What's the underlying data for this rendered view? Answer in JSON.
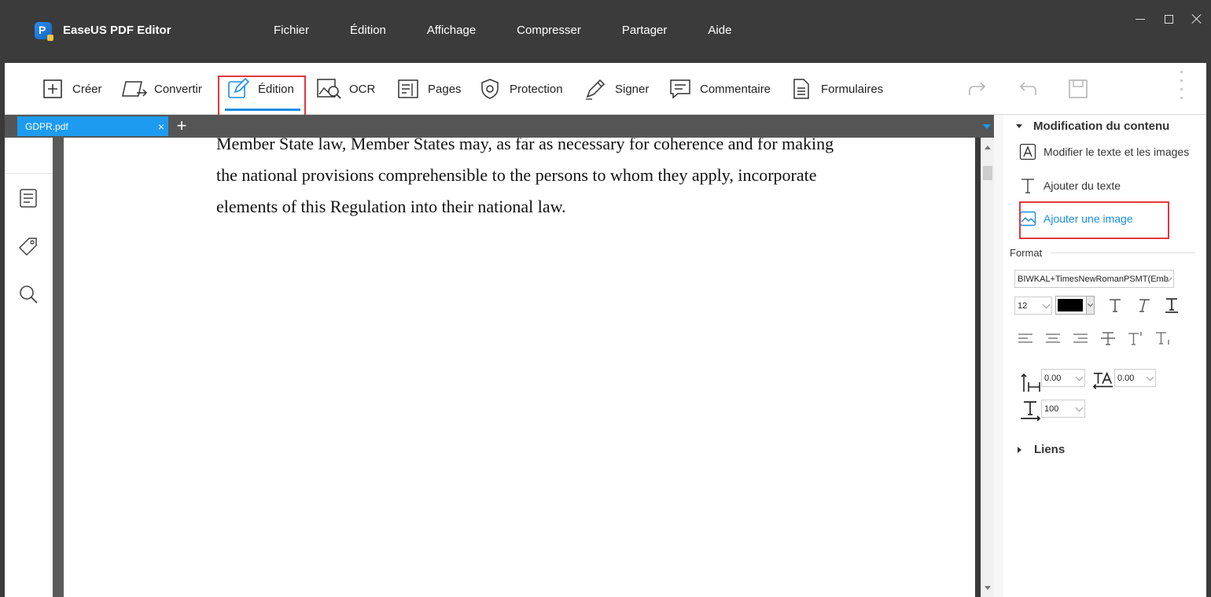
{
  "app": {
    "title": "EaseUS PDF Editor",
    "logo_letter": "P"
  },
  "menubar": {
    "items": [
      "Fichier",
      "Édition",
      "Affichage",
      "Compresser",
      "Partager",
      "Aide"
    ]
  },
  "toolbar": {
    "tools": [
      {
        "label": "Créer",
        "icon": "plus-box-icon"
      },
      {
        "label": "Convertir",
        "icon": "convert-icon"
      },
      {
        "label": "Édition",
        "icon": "pencil-edit-icon",
        "active": true
      },
      {
        "label": "OCR",
        "icon": "ocr-scan-icon"
      },
      {
        "label": "Pages",
        "icon": "pages-icon"
      },
      {
        "label": "Protection",
        "icon": "shield-icon"
      },
      {
        "label": "Signer",
        "icon": "pen-sign-icon"
      },
      {
        "label": "Commentaire",
        "icon": "comment-icon"
      },
      {
        "label": "Formulaires",
        "icon": "form-icon"
      }
    ],
    "right_icons": [
      "redo-icon",
      "undo-icon",
      "save-icon"
    ]
  },
  "tabs": {
    "active_tab": "GDPR.pdf",
    "close_glyph": "×",
    "new_tab_glyph": "+"
  },
  "document": {
    "lines": [
      "Member State law, Member States may, as far as necessary for coherence and for making",
      "the national provisions comprehensible to the persons to whom they apply, incorporate",
      "elements of this Regulation into their national law."
    ]
  },
  "right_panel": {
    "content_section": {
      "title": "Modification du contenu",
      "items": [
        {
          "label": "Modifier le texte et les images",
          "icon": "edit-text-image-icon"
        },
        {
          "label": "Ajouter du texte",
          "icon": "add-text-icon"
        },
        {
          "label": "Ajouter une image",
          "icon": "add-image-icon",
          "highlighted": true
        }
      ]
    },
    "format": {
      "label": "Format",
      "font": "BIWKAL+TimesNewRomanPSMT(Emb",
      "size": "12",
      "color": "#000000",
      "char_spacing": "0.00",
      "word_spacing": "0.00",
      "scale": "100"
    },
    "links_section": {
      "title": "Liens"
    }
  },
  "colors": {
    "accent": "#1a8ee6",
    "highlight": "#e0383e",
    "titlebar": "#3b3b3b",
    "tab": "#1d9bf0"
  }
}
